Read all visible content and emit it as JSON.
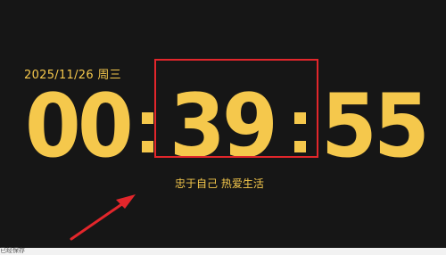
{
  "clock": {
    "date": "2025/11/26  周三",
    "hours": "00",
    "minutes": "39",
    "seconds": "55",
    "slogan": "忠于自己 热爱生活"
  },
  "footer": {
    "text": "已经保存"
  },
  "colors": {
    "background": "#161616",
    "digit": "#f5c84c",
    "annotation": "#e2262b"
  }
}
